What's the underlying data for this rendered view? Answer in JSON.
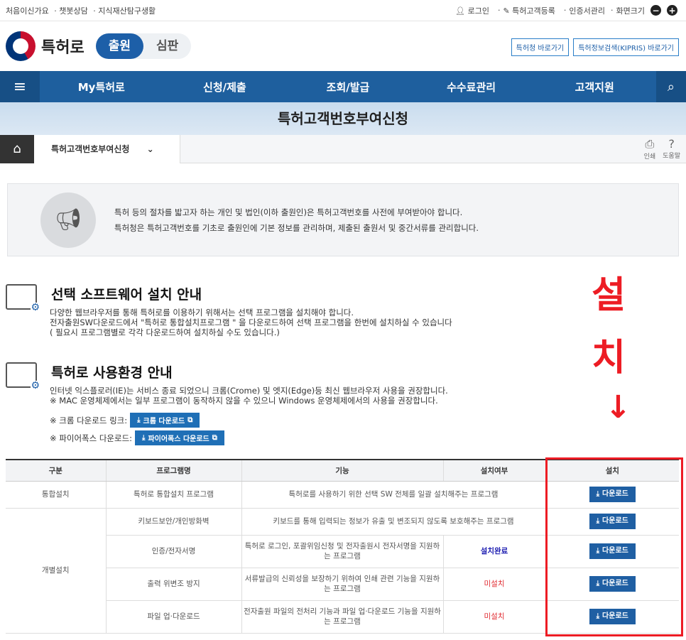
{
  "topbar": {
    "left": [
      "처음이신가요",
      "챗봇상담",
      "지식재산탐구생활"
    ],
    "right": [
      "로그인",
      "특허고객등록",
      "인증서관리",
      "화면크기"
    ],
    "zoom_minus": "−",
    "zoom_plus": "+"
  },
  "header": {
    "brand": "특허로",
    "toggle": [
      "출원",
      "심판"
    ],
    "links": [
      "특허청 바로가기",
      "특허정보검색(KIPRIS) 바로가기"
    ]
  },
  "nav": {
    "menu_icon": "≡",
    "items": [
      "My특허로",
      "신청/제출",
      "조회/발급",
      "수수료관리",
      "고객지원"
    ],
    "search_icon": "⌕"
  },
  "page_title": "특허고객번호부여신청",
  "breadcrumb": {
    "home_icon": "⌂",
    "current": "특허고객번호부여신청",
    "chevron": "⌄",
    "print": "인쇄",
    "help": "도움말"
  },
  "notice": {
    "line1": "특허 등의 절차를 밟고자 하는 개인 및 법인(이하 출원인)은 특허고객번호를 사전에 부여받아야 합니다.",
    "line2": "특허청은 특허고객번호를 기초로 출원인에 기본 정보를 관리하며, 제출된 출원서 및 중간서류를 관리합니다."
  },
  "sw_section": {
    "title": "선택 소프트웨어 설치 안내",
    "line1": "다양한 웹브라우저를 통해 특허로를 이용하기 위해서는 선택 프로그램을 설치해야 합니다.",
    "line2": "전자출원SW다운로드에서 \"특허로 통합설치프로그램 \" 을 다운로드하여 선택 프로그램을 한번에 설치하실 수 있습니다",
    "line3": "( 필요시 프로그램별로 각각 다운로드하여 설치하실 수도 있습니다.)"
  },
  "env_section": {
    "title": "특허로 사용환경 안내",
    "line1": "인터넷 익스플로러(IE)는 서비스 종료 되었으니 크롬(Crome) 및 엣지(Edge)등 최신 웹브라우저 사용을 권장합니다.",
    "line2": "※ MAC 운영체제에서는 일부 프로그램이 동작하지 않을 수 있으니 Windows 운영체제에서의 사용을 권장합니다.",
    "chrome_label": "※ 크롬 다운로드 링크:",
    "chrome_btn": "크롬 다운로드",
    "firefox_label": "※ 파이어폭스 다운로드:",
    "firefox_btn": "파이어폭스 다운로드"
  },
  "annotation": {
    "text1": "설",
    "text2": "치",
    "arrow": "↓"
  },
  "table": {
    "headers": [
      "구분",
      "프로그램명",
      "기능",
      "설치여부",
      "설치"
    ],
    "download_label": "다운로드",
    "rows": [
      {
        "group": "통합설치",
        "name": "특허로 통합설치 프로그램",
        "func": "특허로를 사용하기 위한 선택 SW 전체를 일괄 설치해주는 프로그램",
        "status": ""
      },
      {
        "group": "개별설치",
        "name": "키보드보안/개인방화벽",
        "func": "키보드를 통해 입력되는 정보가 유출 및 변조되지 않도록 보호해주는 프로그램",
        "status": ""
      },
      {
        "group": "",
        "name": "인증/전자서명",
        "func": "특허로 로그인, 포괄위임신청 및 전자출원시 전자서명을 지원하는 프로그램",
        "status": "설치완료"
      },
      {
        "group": "",
        "name": "출력 위변조 방지",
        "func": "서류발급의 신뢰성을 보장하기 위하여 인쇄 관련 기능을 지원하는 프로그램",
        "status": "미설치"
      },
      {
        "group": "",
        "name": "파일 업·다운로드",
        "func": "전자출원 파일의 전처리 기능과 파일 업·다운로드 기능을 지원하는 프로그램",
        "status": "미설치"
      }
    ]
  }
}
